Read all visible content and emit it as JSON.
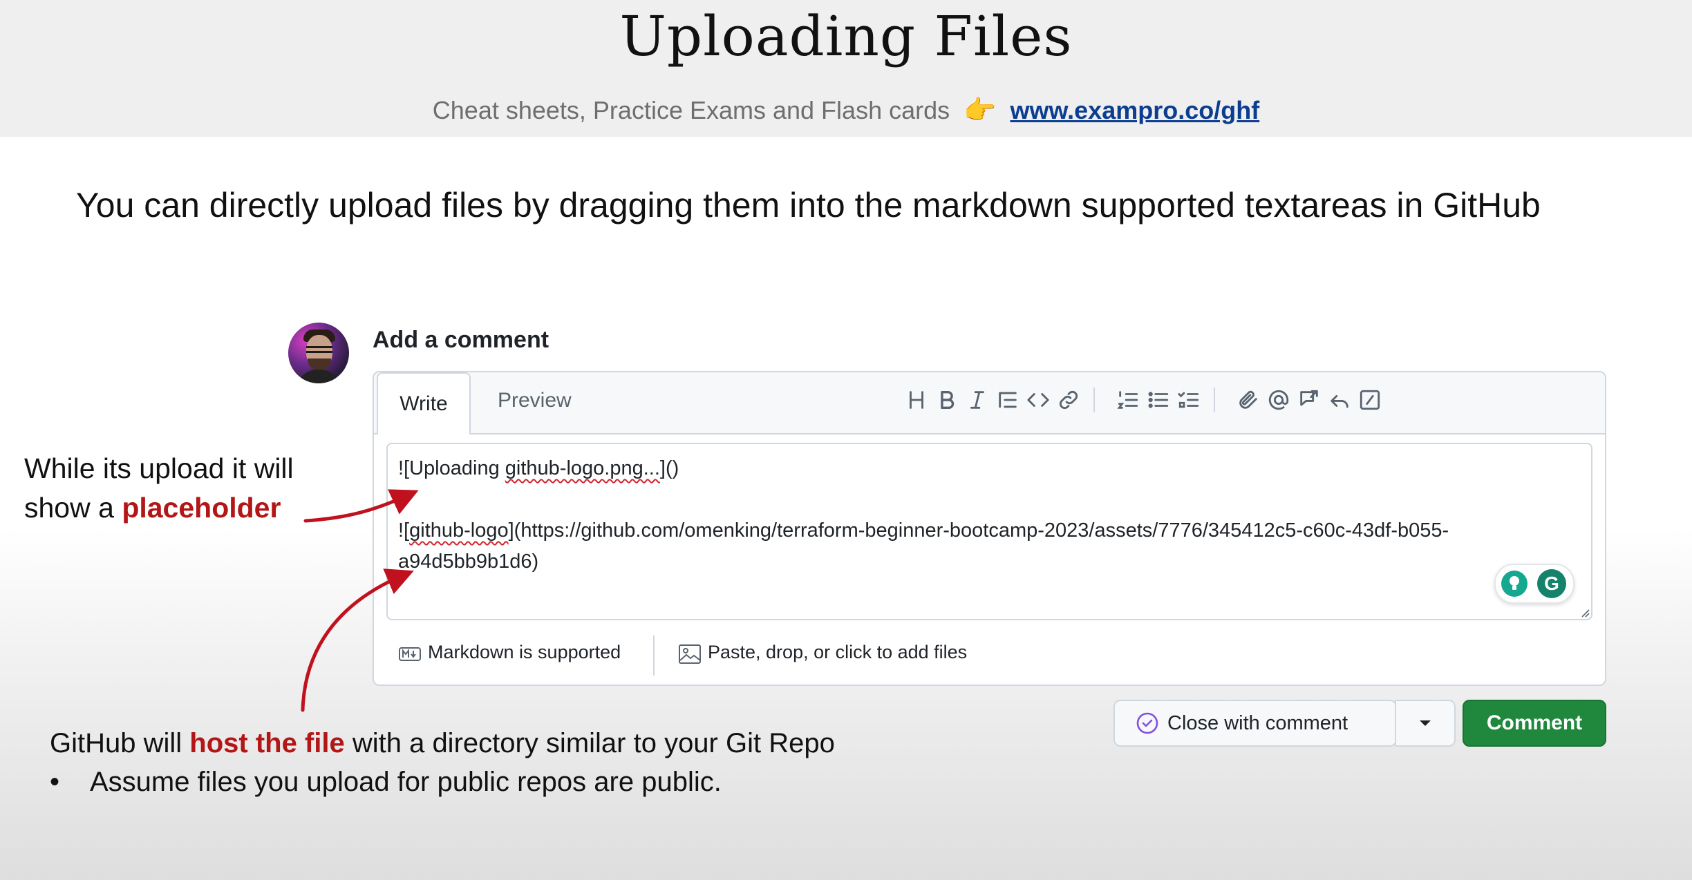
{
  "slide": {
    "title": "Uploading Files",
    "subtitle": "Cheat sheets, Practice Exams and Flash cards",
    "pointer_emoji": "👉",
    "link": "www.exampro.co/ghf",
    "lead": "You can directly upload files by dragging them into the markdown supported textareas in GitHub"
  },
  "comment_box": {
    "heading": "Add a comment",
    "tabs": [
      {
        "label": "Write",
        "active": true
      },
      {
        "label": "Preview",
        "active": false
      }
    ],
    "toolbar": [
      "heading-icon",
      "bold-icon",
      "italic-icon",
      "quote-icon",
      "code-icon",
      "link-icon",
      "numbered-list-icon",
      "bulleted-list-icon",
      "task-list-icon",
      "attach-icon",
      "mention-icon",
      "reference-icon",
      "reply-icon",
      "slash-command-icon"
    ],
    "textarea": {
      "line1_prefix": "![Uploading ",
      "line1_squiggle": "github-logo.png...",
      "line1_suffix": "]()",
      "line2_prefix": "![",
      "line2_squiggle": "github-logo",
      "line2_rest": "](https://github.com/omenking/terraform-beginner-bootcamp-2023/assets/7776/345412c5-c60c-43df-b055-",
      "line3": "a94d5bb9b1d6)"
    },
    "footer": {
      "markdown": "Markdown is supported",
      "paste": "Paste, drop, or click to add files"
    },
    "grammarly_letter": "G",
    "buttons": {
      "close": "Close with comment",
      "comment": "Comment"
    }
  },
  "annotations": {
    "upload_line1": "While its upload it will",
    "upload_line2_prefix": "show a ",
    "upload_highlight": "placeholder",
    "host_prefix": "GitHub will ",
    "host_highlight": "host the file",
    "host_suffix": " with a directory similar to your Git Repo",
    "bullet_marker": "•",
    "bullet_text": "Assume files you upload for public repos are public."
  },
  "colors": {
    "accent_red": "#b21616",
    "comment_green": "#1f883d",
    "link_blue": "#0b3d91",
    "grammarly": "#15836b",
    "close_icon_purple": "#8250df"
  }
}
